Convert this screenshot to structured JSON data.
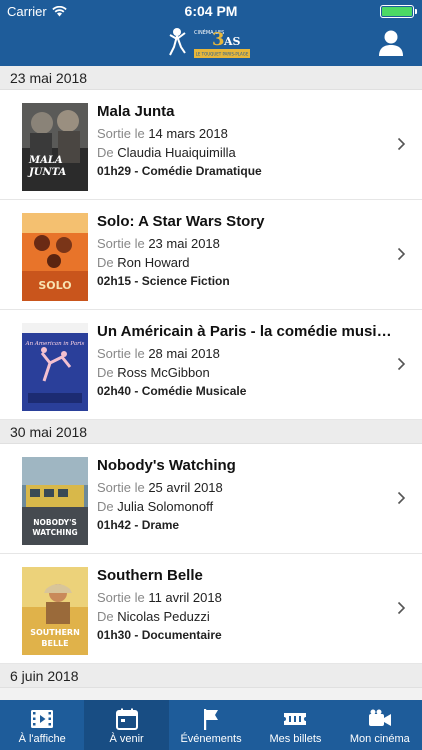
{
  "status": {
    "carrier": "Carrier",
    "time": "6:04 PM"
  },
  "header": {
    "logo_top": "CINÉMA LES",
    "logo_num": "3",
    "logo_as": "AS",
    "logo_sub": "LE TOUQUET PARIS-PLAGE"
  },
  "sections": [
    {
      "date": "23 mai 2018",
      "movies": [
        {
          "title": "Mala Junta",
          "release_prefix": "Sortie le",
          "release_date": "14 mars 2018",
          "director_prefix": "De",
          "director": "Claudia Huaiquimilla",
          "info": "01h29 - Comédie Dramatique"
        },
        {
          "title": "Solo: A Star Wars Story",
          "release_prefix": "Sortie le",
          "release_date": "23 mai 2018",
          "director_prefix": "De",
          "director": "Ron Howard",
          "info": "02h15 - Science Fiction"
        },
        {
          "title": "Un Américain à Paris - la comédie musicale a...",
          "release_prefix": "Sortie le",
          "release_date": "28 mai 2018",
          "director_prefix": "De",
          "director": "Ross McGibbon",
          "info": "02h40 - Comédie Musicale"
        }
      ]
    },
    {
      "date": "30 mai 2018",
      "movies": [
        {
          "title": "Nobody's Watching",
          "release_prefix": "Sortie le",
          "release_date": "25 avril 2018",
          "director_prefix": "De",
          "director": "Julia Solomonoff",
          "info": "01h42 - Drame"
        },
        {
          "title": "Southern Belle",
          "release_prefix": "Sortie le",
          "release_date": "11 avril 2018",
          "director_prefix": "De",
          "director": "Nicolas Peduzzi",
          "info": "01h30 - Documentaire"
        }
      ]
    },
    {
      "date": "6 juin 2018",
      "movies": []
    }
  ],
  "posters": {
    "p1": {
      "line1": "MALA",
      "line2": "JUNTA"
    },
    "p2": {
      "line1": "SOLO"
    },
    "p3": {
      "line1": "An American in Paris"
    },
    "p4": {
      "line1": "NOBODY'S",
      "line2": "WATCHING"
    },
    "p5": {
      "line1": "SOUTHERN",
      "line2": "BELLE"
    }
  },
  "tabs": [
    {
      "label": "À l'affiche",
      "icon": "film-icon",
      "active": false
    },
    {
      "label": "À venir",
      "icon": "calendar-icon",
      "active": true
    },
    {
      "label": "Événements",
      "icon": "flag-icon",
      "active": false
    },
    {
      "label": "Mes billets",
      "icon": "ticket-icon",
      "active": false
    },
    {
      "label": "Mon cinéma",
      "icon": "camera-icon",
      "active": false
    }
  ],
  "colors": {
    "brand_blue": "#1e5c9a",
    "tab_active": "#184d83",
    "battery_green": "#4cd964",
    "logo_gold": "#e8b73a"
  }
}
